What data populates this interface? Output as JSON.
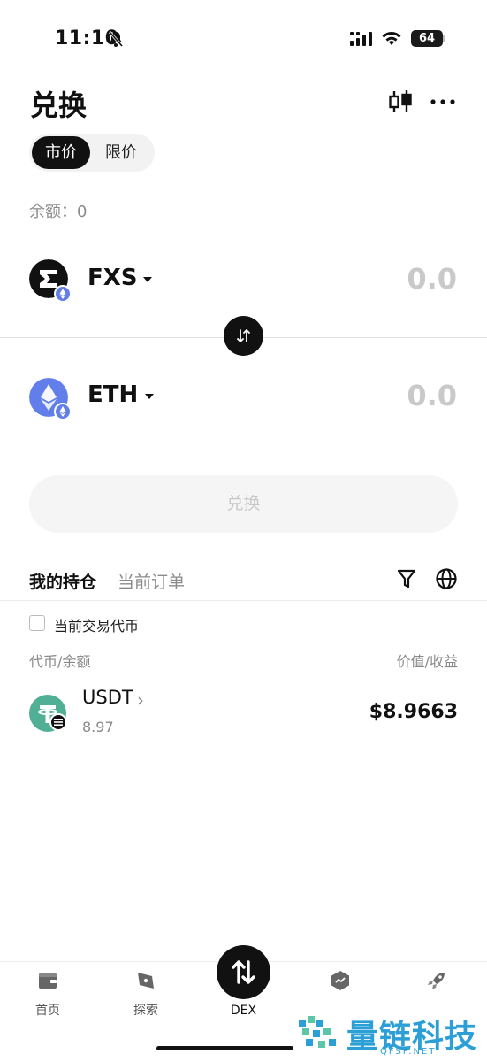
{
  "status": {
    "time": "11:10",
    "battery": "64"
  },
  "header": {
    "title": "兑换"
  },
  "mode_tabs": {
    "market": "市价",
    "limit": "限价"
  },
  "balance_label": "余额：0",
  "from_token": {
    "symbol": "FXS",
    "amount": "0.0"
  },
  "to_token": {
    "symbol": "ETH",
    "amount": "0.0"
  },
  "swap_button": "兑换",
  "holdings": {
    "tab_mine": "我的持仓",
    "tab_orders": "当前订单",
    "checkbox_label": "当前交易代币",
    "col_left": "代币/余额",
    "col_right": "价值/收益",
    "rows": [
      {
        "symbol": "USDT",
        "chevron": "›",
        "balance": "8.97",
        "value": "$8.9663"
      }
    ]
  },
  "nav": {
    "items": [
      {
        "label": "首页",
        "icon": "wallet-icon"
      },
      {
        "label": "探索",
        "icon": "compass-icon"
      },
      {
        "label": "DEX",
        "icon": "swap-icon"
      },
      {
        "label": "",
        "icon": "defi-icon"
      },
      {
        "label": "",
        "icon": "rocket-icon"
      }
    ]
  },
  "watermark": {
    "text": "量链科技",
    "sub": "QFSP.NET"
  },
  "colors": {
    "accent": "#111111",
    "eth": "#627eea",
    "usdt": "#50af95",
    "watermark": "#2b9fd6"
  }
}
